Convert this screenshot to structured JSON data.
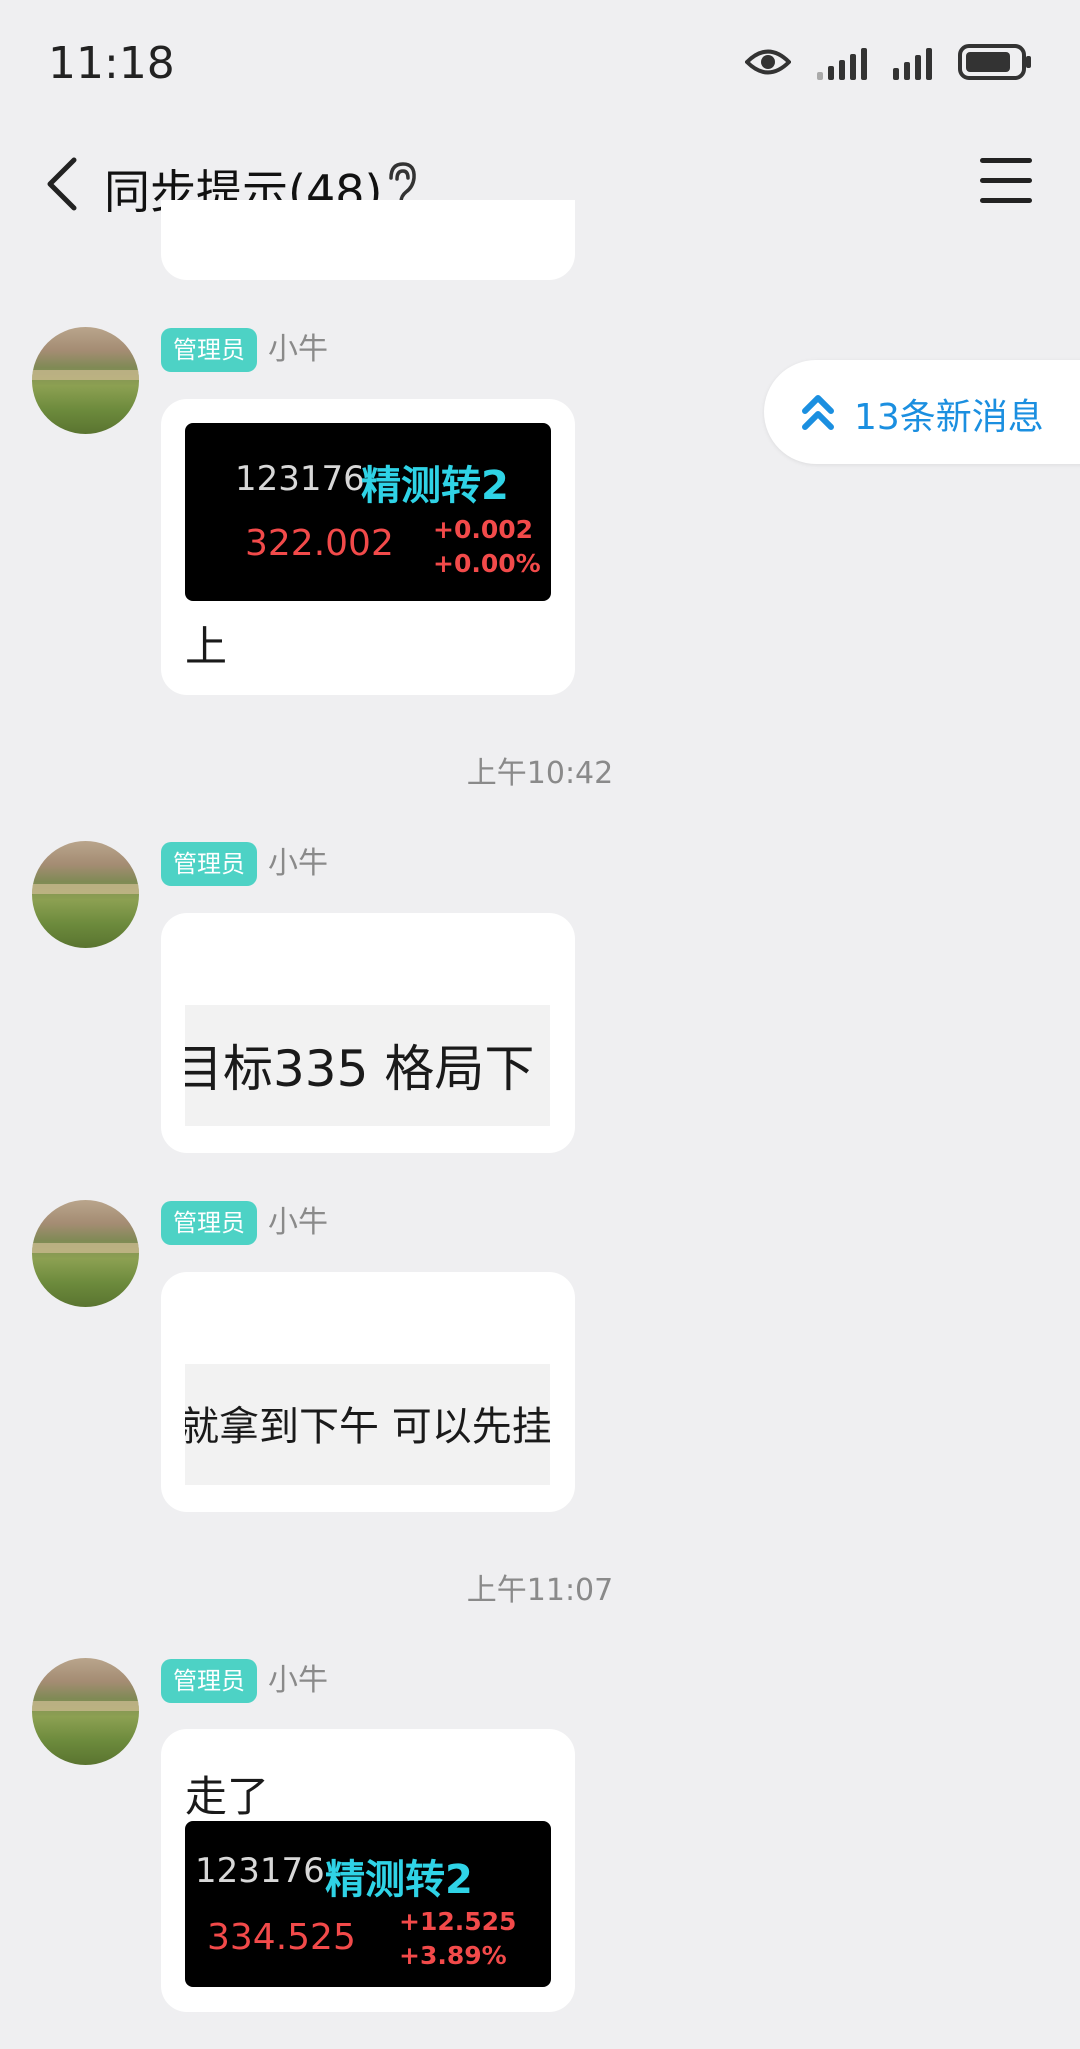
{
  "status_bar": {
    "time": "11:18"
  },
  "header": {
    "title": "同步提示(48)"
  },
  "new_messages_pill": {
    "label": "13条新消息"
  },
  "messages": [
    {
      "badge": "管理员",
      "sender": "小牛",
      "quote": {
        "code": "123176",
        "name": "精测转2",
        "price": "322.002",
        "change": "+0.002",
        "change_pct": "+0.00%"
      },
      "text": "上"
    },
    {
      "timestamp": "上午10:42"
    },
    {
      "badge": "管理员",
      "sender": "小牛",
      "image_text": "目标335  格局下"
    },
    {
      "badge": "管理员",
      "sender": "小牛",
      "image_text": "就拿到下午 可以先挂卖"
    },
    {
      "timestamp": "上午11:07"
    },
    {
      "badge": "管理员",
      "sender": "小牛",
      "text": "走了",
      "quote": {
        "code": "123176",
        "name": "精测转2",
        "price": "334.525",
        "change": "+12.525",
        "change_pct": "+3.89%"
      }
    }
  ],
  "colors": {
    "background": "#efeff1",
    "badge": "#4dd2c5",
    "accent": "#1b8fe0",
    "quote_name": "#2fd3e6",
    "quote_price": "#f24a4a"
  }
}
